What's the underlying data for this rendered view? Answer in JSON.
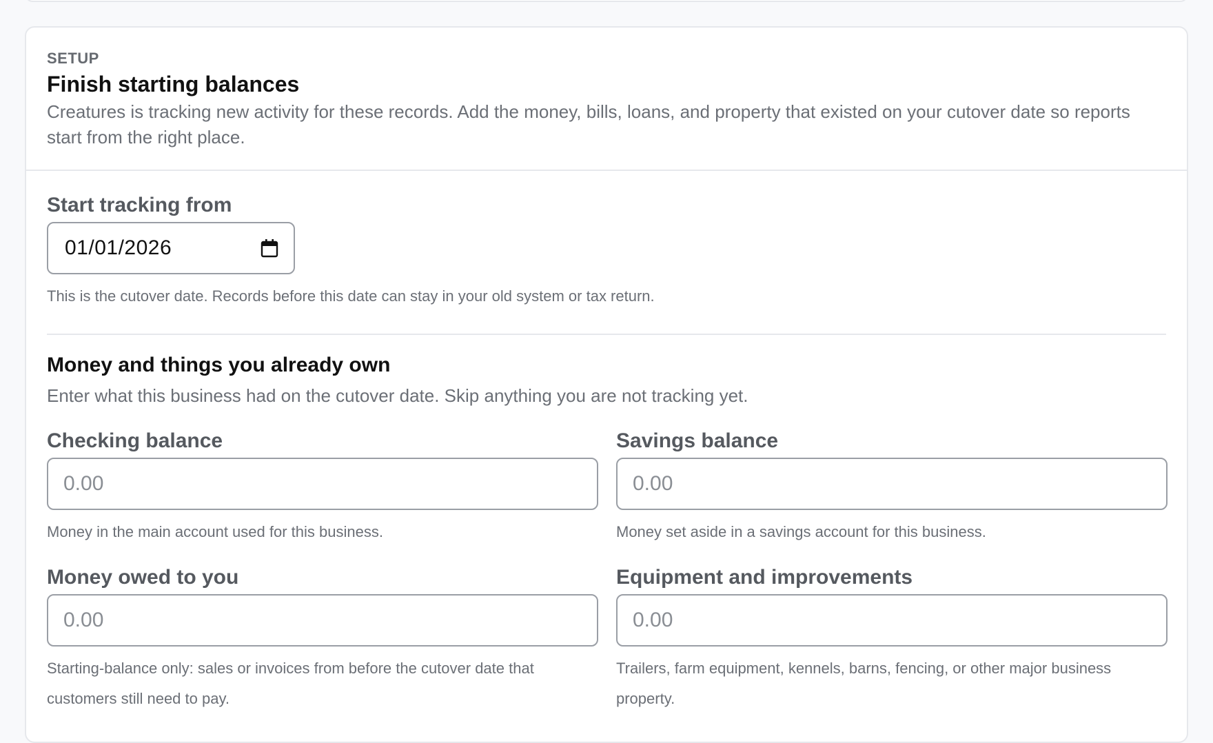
{
  "header": {
    "eyebrow": "SETUP",
    "title": "Finish starting balances",
    "description": "Creatures is tracking new activity for these records. Add the money, bills, loans, and property that existed on your cutover date so reports start from the right place."
  },
  "start_tracking": {
    "label": "Start tracking from",
    "value": "01/01/2026",
    "icon": "calendar-icon",
    "help": "This is the cutover date. Records before this date can stay in your old system or tax return."
  },
  "owned_section": {
    "title": "Money and things you already own",
    "description": "Enter what this business had on the cutover date. Skip anything you are not tracking yet."
  },
  "fields": {
    "checking": {
      "label": "Checking balance",
      "placeholder": "0.00",
      "help": "Money in the main account used for this business."
    },
    "savings": {
      "label": "Savings balance",
      "placeholder": "0.00",
      "help": "Money set aside in a savings account for this business."
    },
    "owed": {
      "label": "Money owed to you",
      "placeholder": "0.00",
      "help": "Starting-balance only: sales or invoices from before the cutover date that customers still need to pay."
    },
    "equipment": {
      "label": "Equipment and improvements",
      "placeholder": "0.00",
      "help": "Trailers, farm equipment, kennels, barns, fencing, or other major business property."
    }
  }
}
